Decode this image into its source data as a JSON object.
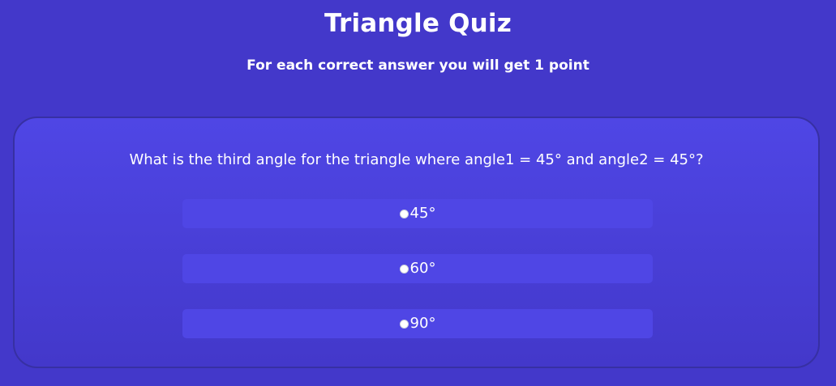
{
  "header": {
    "title": "Triangle Quiz",
    "subtitle": "For each correct answer you will get 1 point"
  },
  "quiz": {
    "question": "What is the third angle for the triangle where angle1 = 45° and angle2 = 45°?",
    "options": [
      {
        "label": "45°"
      },
      {
        "label": "60°"
      },
      {
        "label": "90°"
      }
    ]
  },
  "colors": {
    "background": "#4338ca",
    "card": "#4f46e5",
    "option": "#4f46e5",
    "text": "#ffffff"
  }
}
